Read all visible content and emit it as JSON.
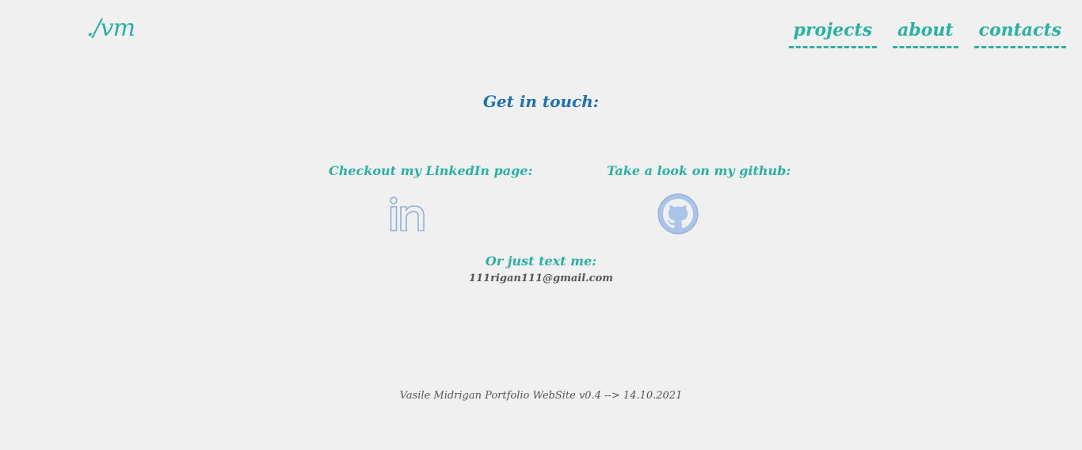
{
  "header": {
    "logo": "./vm",
    "nav": [
      {
        "label": "projects"
      },
      {
        "label": "about"
      },
      {
        "label": "contacts"
      }
    ]
  },
  "main": {
    "headline": "Get in touch:",
    "linkedin": {
      "title": "Checkout my LinkedIn page:",
      "icon": "linkedin-icon"
    },
    "github": {
      "title": "Take a look on my github:",
      "icon": "github-icon"
    },
    "text_me": {
      "title": "Or just text me:",
      "email": "111rigan111@gmail.com"
    }
  },
  "footer": {
    "text": "Vasile Midrigan Portfolio WebSite v0.4 --> 14.10.2021"
  },
  "colors": {
    "background": "#f0f0f0",
    "accent": "#2bb0a5",
    "headline": "#1e72b0",
    "icon": "#8fb0dc",
    "text": "#555555"
  }
}
